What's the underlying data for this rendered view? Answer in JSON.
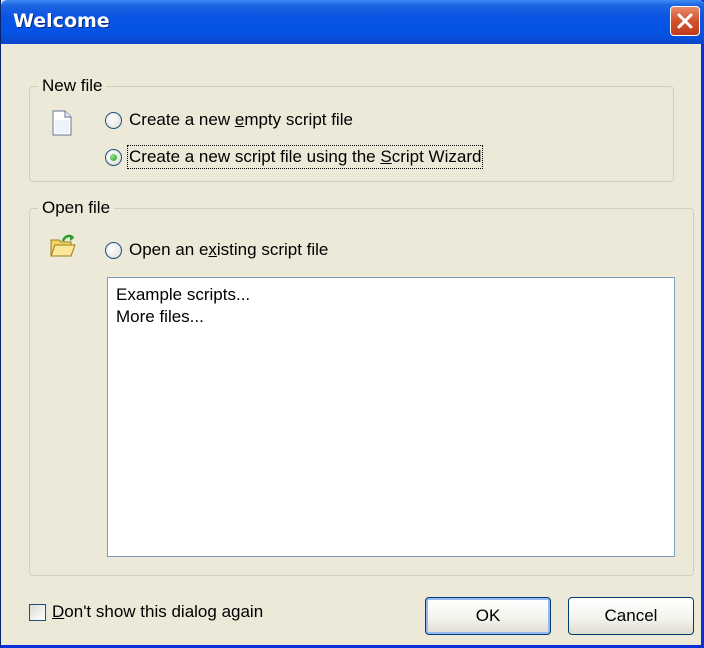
{
  "window": {
    "title": "Welcome"
  },
  "new_file_group": {
    "legend": "New file",
    "option_empty": {
      "before": "Create a new ",
      "mnemonic": "e",
      "after": "mpty script file",
      "checked": false
    },
    "option_wizard": {
      "before": "Create a new script file using the ",
      "mnemonic": "S",
      "after": "cript Wizard",
      "checked": true
    }
  },
  "open_file_group": {
    "legend": "Open file",
    "option_existing": {
      "before": "Open an e",
      "mnemonic": "x",
      "after": "isting script file",
      "checked": false
    },
    "list_items": [
      "Example scripts...",
      "More files..."
    ]
  },
  "footer": {
    "dont_show": {
      "mnemonic": "D",
      "after": "on't show this dialog again",
      "checked": false
    },
    "ok_label": "OK",
    "cancel_label": "Cancel"
  },
  "colors": {
    "titlebar": "#0a54e3",
    "dialog_bg": "#ece9d8",
    "close_button": "#d4512e",
    "radio_checked": "#21a121"
  },
  "icons": {
    "new_file": "document-icon",
    "open_file": "open-folder-icon",
    "close": "close-icon"
  }
}
